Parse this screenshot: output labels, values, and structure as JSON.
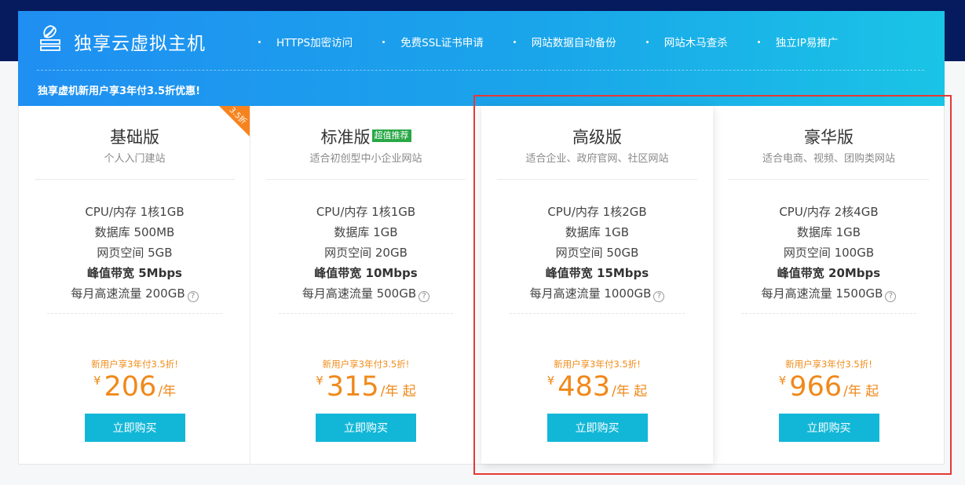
{
  "hero": {
    "title": "独享云虚拟主机",
    "features": [
      "HTTPS加密访问",
      "免费SSL证书申请",
      "网站数据自动备份",
      "网站木马查杀",
      "独立IP易推广"
    ],
    "promo": "独享虚机新用户享3年付3.5折优惠!"
  },
  "plans": [
    {
      "name": "基础版",
      "tag": "",
      "corner": "3.5折",
      "desc": "个人入门建站",
      "specs": [
        "CPU/内存 1核1GB",
        "数据库 500MB",
        "网页空间 5GB",
        "峰值带宽 5Mbps",
        "每月高速流量 200GB"
      ],
      "ribbon": "新用户享3年付3.5折!",
      "currency": "¥",
      "price": "206",
      "unit": "/年",
      "buy": "立即购买"
    },
    {
      "name": "标准版",
      "tag": "超值推荐",
      "corner": "",
      "desc": "适合初创型中小企业网站",
      "specs": [
        "CPU/内存 1核1GB",
        "数据库 1GB",
        "网页空间 20GB",
        "峰值带宽 10Mbps",
        "每月高速流量 500GB"
      ],
      "ribbon": "新用户享3年付3.5折!",
      "currency": "¥",
      "price": "315",
      "unit": "/年 起",
      "buy": "立即购买"
    },
    {
      "name": "高级版",
      "tag": "",
      "corner": "",
      "desc": "适合企业、政府官网、社区网站",
      "specs": [
        "CPU/内存 1核2GB",
        "数据库 1GB",
        "网页空间 50GB",
        "峰值带宽 15Mbps",
        "每月高速流量 1000GB"
      ],
      "ribbon": "新用户享3年付3.5折!",
      "currency": "¥",
      "price": "483",
      "unit": "/年 起",
      "buy": "立即购买"
    },
    {
      "name": "豪华版",
      "tag": "",
      "corner": "",
      "desc": "适合电商、视频、团购类网站",
      "specs": [
        "CPU/内存 2核4GB",
        "数据库 1GB",
        "网页空间 100GB",
        "峰值带宽 20Mbps",
        "每月高速流量 1500GB"
      ],
      "ribbon": "新用户享3年付3.5折!",
      "currency": "¥",
      "price": "966",
      "unit": "/年 起",
      "buy": "立即购买"
    }
  ],
  "colors": {
    "accent_orange": "#f0891a",
    "buy_button": "#12b7d8",
    "tag_green": "#28a745",
    "highlight_red": "#e53935"
  },
  "icons": {
    "logo": "cloud-server-leaf-icon",
    "help": "question-circle-icon"
  }
}
